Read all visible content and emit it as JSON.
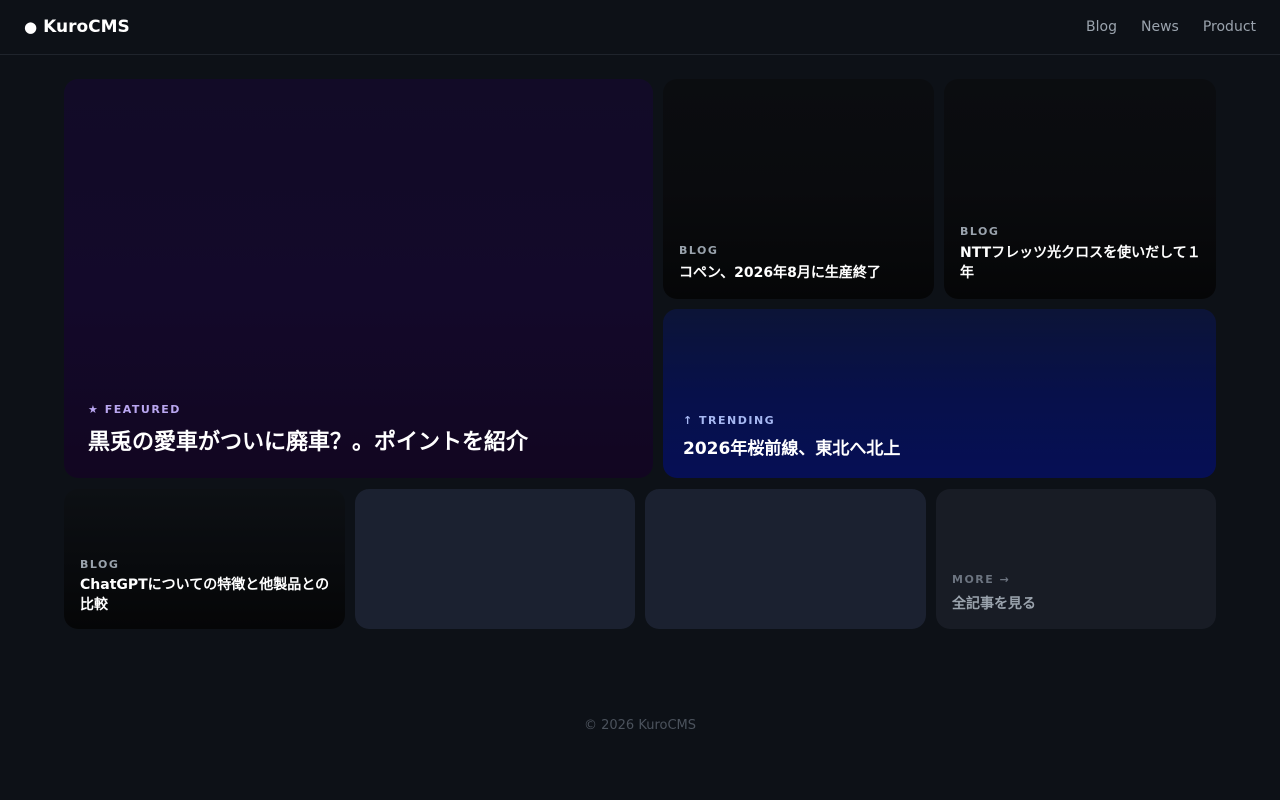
{
  "header": {
    "brand_dot": "●",
    "brand": "KuroCMS",
    "nav": [
      "Blog",
      "News",
      "Product"
    ]
  },
  "featured": {
    "category": "★ FEATURED",
    "title": "黒兎の愛車がついに廃車？。ポイントを紹介"
  },
  "cards": {
    "copen": {
      "category": "BLOG",
      "title": "コペン、2026年8月に生産終了"
    },
    "ntt": {
      "category": "BLOG",
      "title": "NTTフレッツ光クロスを使いだして１年"
    },
    "trending": {
      "category": "↑ TRENDING",
      "title": "2026年桜前線、東北へ北上"
    },
    "chatgpt": {
      "category": "BLOG",
      "title": "ChatGPTについての特徴と他製品との比較"
    },
    "more": {
      "category": "MORE →",
      "title": "全記事を見る"
    }
  },
  "footer": {
    "copyright": "© 2026 KuroCMS"
  }
}
